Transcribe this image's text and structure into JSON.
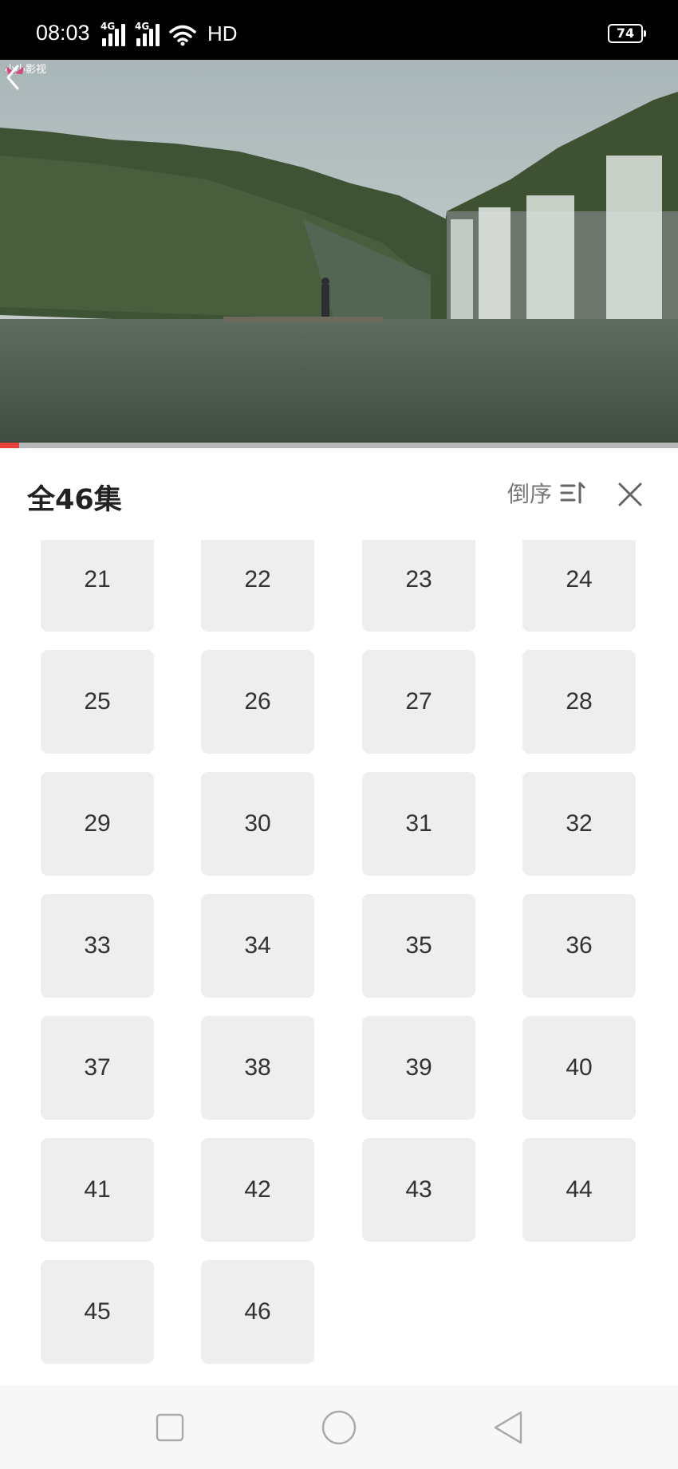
{
  "status_bar": {
    "time": "08:03",
    "network_1": "4G",
    "network_2": "4G",
    "hd": "HD",
    "battery": "74"
  },
  "video": {
    "watermark": "小小影视",
    "progress_fraction": 0.028
  },
  "panel": {
    "title": "全46集",
    "sort_label": "倒序",
    "episodes": [
      "21",
      "22",
      "23",
      "24",
      "25",
      "26",
      "27",
      "28",
      "29",
      "30",
      "31",
      "32",
      "33",
      "34",
      "35",
      "36",
      "37",
      "38",
      "39",
      "40",
      "41",
      "42",
      "43",
      "44",
      "45",
      "46"
    ]
  },
  "colors": {
    "accent": "#e8403a",
    "episode_bg": "#eeeeee"
  },
  "icons": {
    "back": "back-arrow-icon",
    "sort": "sort-order-icon",
    "close": "close-icon",
    "nav": [
      "square-recent-icon",
      "circle-home-icon",
      "triangle-back-icon"
    ]
  }
}
